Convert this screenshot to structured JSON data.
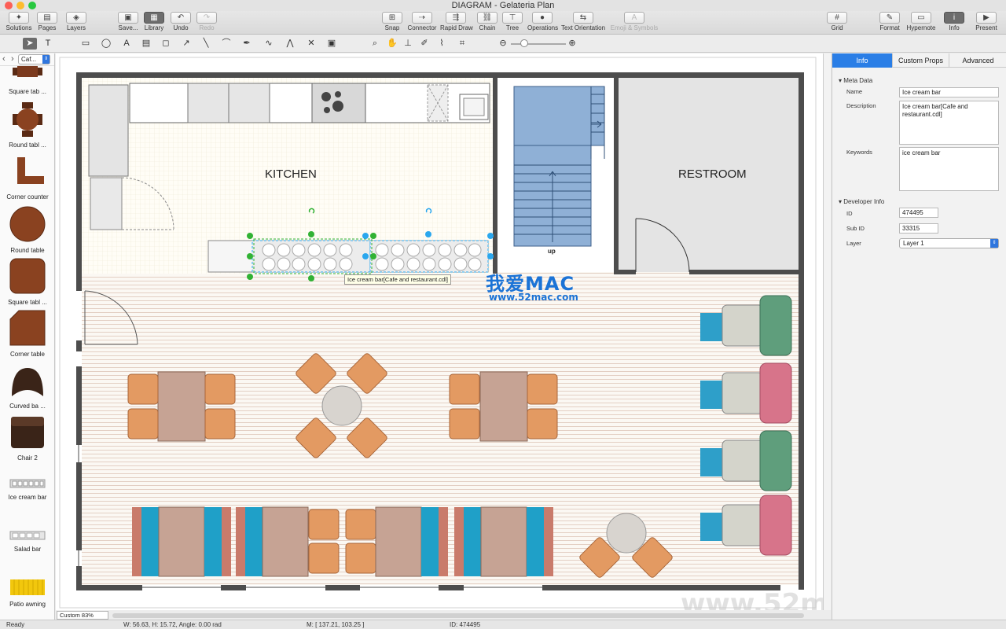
{
  "window": {
    "title": "DIAGRAM - Gelateria Plan"
  },
  "toolbar": {
    "solutions": "Solutions",
    "pages": "Pages",
    "layers": "Layers",
    "save": "Save...",
    "library": "Library",
    "undo": "Undo",
    "redo": "Redo",
    "snap": "Snap",
    "connector": "Connector",
    "rapid_draw": "Rapid Draw",
    "chain": "Chain",
    "tree": "Tree",
    "operations": "Operations",
    "text_orientation": "Text Orientation",
    "emoji": "Emoji & Symbols",
    "grid": "Grid",
    "format": "Format",
    "hypernote": "Hypernote",
    "info": "Info",
    "present": "Present"
  },
  "library": {
    "selected": "Caf...",
    "items": [
      {
        "label": "Square tab ..."
      },
      {
        "label": "Round tabl ..."
      },
      {
        "label": "Corner counter"
      },
      {
        "label": "Round table"
      },
      {
        "label": "Square tabl ..."
      },
      {
        "label": "Corner table"
      },
      {
        "label": "Curved ba ..."
      },
      {
        "label": "Chair 2"
      },
      {
        "label": "Ice cream bar"
      },
      {
        "label": "Salad bar"
      },
      {
        "label": "Patio awning"
      }
    ]
  },
  "canvas": {
    "kitchen_label": "KITCHEN",
    "restroom_label": "RESTROOM",
    "stairs_label": "up",
    "tooltip": "Ice cream bar[Cafe and restaurant.cdl]",
    "watermark_cn": "我爱MAC",
    "watermark_url": "www.52mac.com",
    "watermark_bottom": "www.52mac.com"
  },
  "info_panel": {
    "tabs": [
      "Info",
      "Custom Props",
      "Advanced"
    ],
    "meta_title": "Meta Data",
    "name_label": "Name",
    "name_value": "Ice cream bar",
    "description_label": "Description",
    "description_value": "Ice cream bar[Cafe and restaurant.cdl]",
    "keywords_label": "Keywords",
    "keywords_value": "ice cream bar",
    "dev_title": "Developer Info",
    "id_label": "ID",
    "id_value": "474495",
    "subid_label": "Sub ID",
    "subid_value": "33315",
    "layer_label": "Layer",
    "layer_value": "Layer 1"
  },
  "status": {
    "zoom": "Custom 83%",
    "ready": "Ready",
    "dims": "W: 56.63,  H: 15.72,  Angle: 0.00 rad",
    "mouse": "M: [ 137.21, 103.25 ]",
    "id": "ID: 474495"
  },
  "colors": {
    "accent": "#2a7ee6",
    "wall": "#4d4d4d",
    "chair": "#e39a62",
    "table": "#c6a394",
    "stairs": "#8fb0d6",
    "selection_green": "#31b234",
    "selection_blue": "#2aa7ee"
  }
}
